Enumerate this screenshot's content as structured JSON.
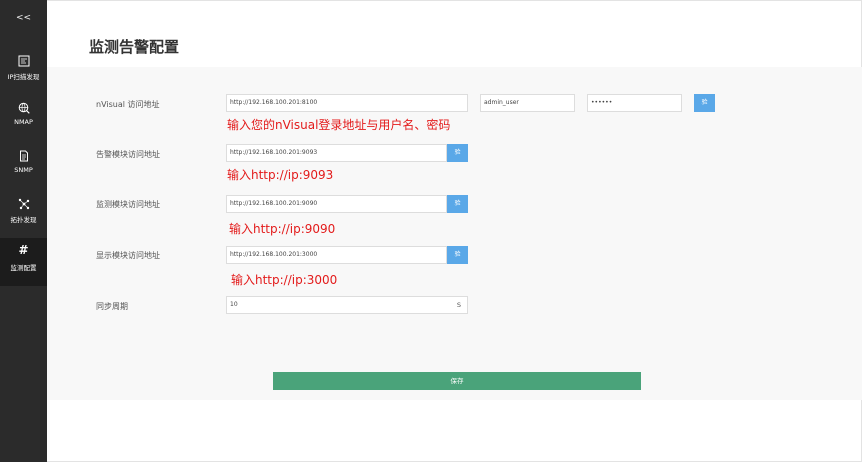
{
  "sidebar": {
    "collapse_label": "<<",
    "items": [
      {
        "label": "IP扫描发现",
        "icon": "ip-scan-icon"
      },
      {
        "label": "NMAP",
        "icon": "globe-search-icon"
      },
      {
        "label": "SNMP",
        "icon": "document-icon"
      },
      {
        "label": "拓扑发现",
        "icon": "topology-icon"
      },
      {
        "label": "监测配置",
        "icon": "hash-icon",
        "glyph": "#"
      }
    ]
  },
  "page": {
    "title": "监测告警配置"
  },
  "form": {
    "nvisual": {
      "label": "nVisual 访问地址",
      "url": "http://192.168.100.201:8100",
      "username": "admin_user",
      "password": "••••••",
      "verify_label": "验"
    },
    "alert": {
      "label": "告警模块访问地址",
      "url": "http://192.168.100.201:9093",
      "verify_label": "验"
    },
    "monitor": {
      "label": "监测模块访问地址",
      "url": "http://192.168.100.201:9090",
      "verify_label": "验"
    },
    "display": {
      "label": "显示模块访问地址",
      "url": "http://192.168.100.201:3000",
      "verify_label": "验"
    },
    "sync": {
      "label": "同步周期",
      "value": "10",
      "unit": "S"
    },
    "save_label": "保存"
  },
  "annotations": {
    "nvisual_hint": "输入您的nVisual登录地址与用户名、密码",
    "alert_hint": "输入http://ip:9093",
    "monitor_hint": "输入http://ip:9090",
    "display_hint": "输入http://ip:3000"
  },
  "colors": {
    "sidebar_bg": "#2b2b2b",
    "accent_blue": "#5aa8e8",
    "save_green": "#4aa37a",
    "hint_red": "#e31b1b"
  }
}
